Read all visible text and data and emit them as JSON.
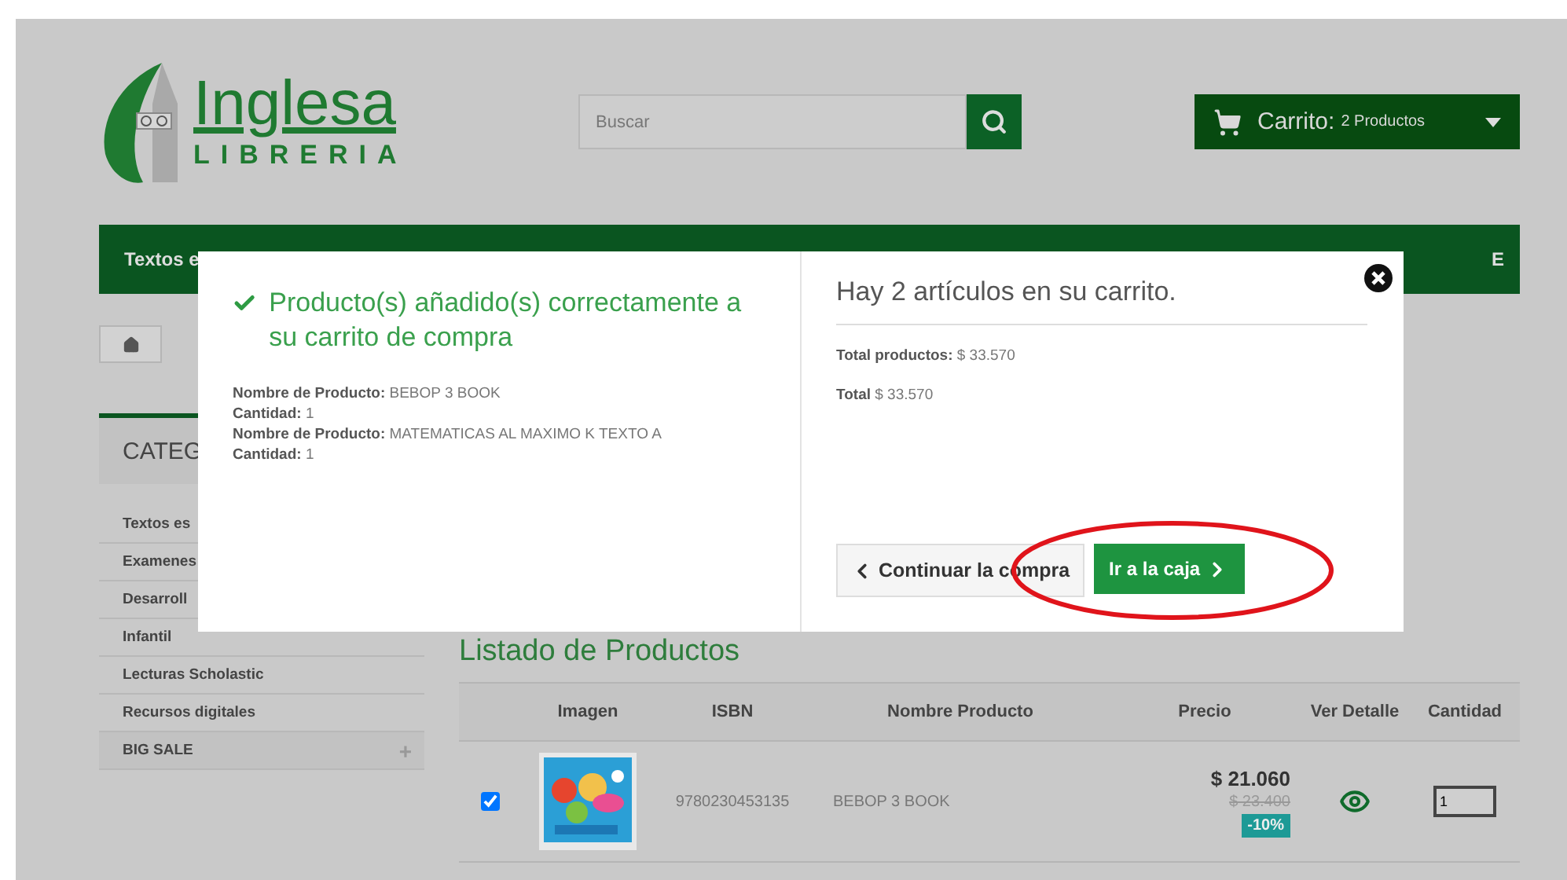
{
  "header": {
    "logo": {
      "title": "Inglesa",
      "subtitle": "LIBRERIA"
    },
    "search": {
      "placeholder": "Buscar"
    },
    "cart": {
      "label": "Carrito:",
      "count": "2 Productos"
    }
  },
  "nav": {
    "items": [
      "Textos e",
      "E"
    ]
  },
  "sidebar": {
    "title": "CATEG",
    "items": [
      {
        "label": "Textos es"
      },
      {
        "label": "Examenes"
      },
      {
        "label": "Desarroll"
      },
      {
        "label": "Infantil"
      },
      {
        "label": "Lecturas Scholastic"
      },
      {
        "label": "Recursos digitales"
      },
      {
        "label": "BIG SALE",
        "toggle": "+"
      }
    ]
  },
  "listing": {
    "title": "Listado de Productos",
    "columns": [
      "Imagen",
      "ISBN",
      "Nombre Producto",
      "Precio",
      "Ver Detalle",
      "Cantidad"
    ],
    "rows": [
      {
        "checked": true,
        "isbn": "9780230453135",
        "name": "BEBOP 3 BOOK",
        "price": "$ 21.060",
        "old_price": "$ 23.400",
        "discount": "-10%",
        "quantity": "1"
      }
    ]
  },
  "modal": {
    "title": "Producto(s) añadido(s) correctamente a su carrito de compra",
    "lines": [
      "**Nombre de Producto:** BEBOP 3 BOOK",
      "**Cantidad:** 1",
      "**Nombre de Producto:** MATEMATICAS AL MAXIMO K TEXTO A",
      "**Cantidad:** 1"
    ],
    "summary": "Hay 2 artículos en su carrito.",
    "totals": [
      "**Total productos:** $ 33.570",
      "**Total** $ 33.570"
    ],
    "continue_button": "Continuar la compra",
    "checkout_button": "Ir a la caja"
  }
}
